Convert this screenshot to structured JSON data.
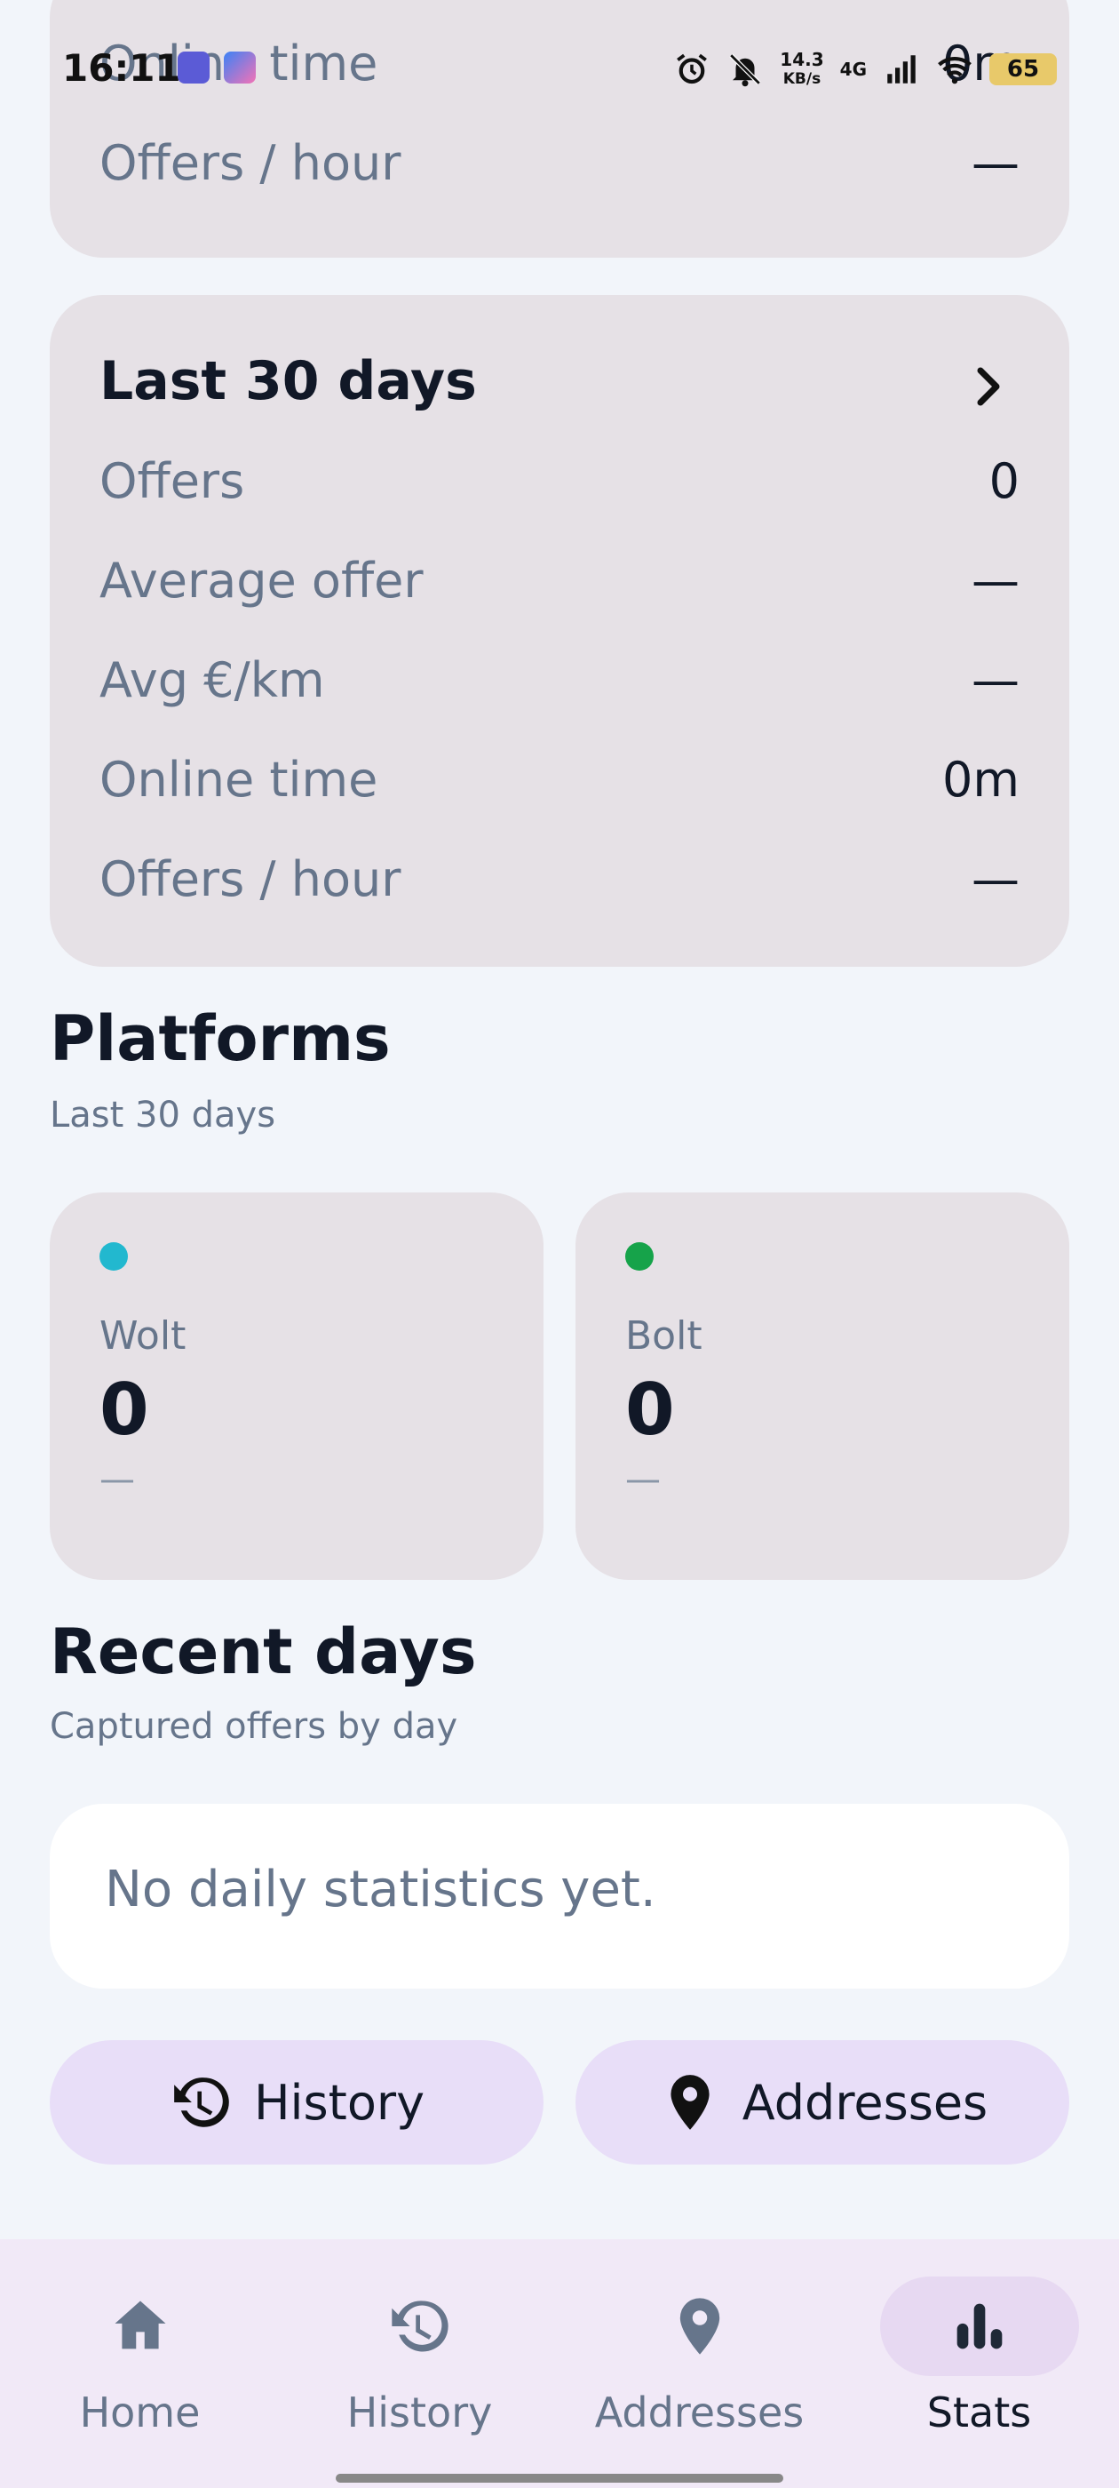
{
  "status_bar": {
    "time": "16:11",
    "net_speed_value": "14.3",
    "net_speed_unit": "KB/s",
    "network_type": "4G",
    "battery": "65"
  },
  "top_card": {
    "rows": [
      {
        "label": "Online time",
        "value": "0m"
      },
      {
        "label": "Offers / hour",
        "value": "—"
      }
    ]
  },
  "last30_card": {
    "title": "Last 30 days",
    "rows": [
      {
        "label": "Offers",
        "value": "0"
      },
      {
        "label": "Average offer",
        "value": "—"
      },
      {
        "label": "Avg €/km",
        "value": "—"
      },
      {
        "label": "Online time",
        "value": "0m"
      },
      {
        "label": "Offers / hour",
        "value": "—"
      }
    ]
  },
  "platforms": {
    "title": "Platforms",
    "subtitle": "Last 30 days",
    "items": [
      {
        "name": "Wolt",
        "count": "0",
        "sub": "—",
        "color": "#22b8cf"
      },
      {
        "name": "Bolt",
        "count": "0",
        "sub": "—",
        "color": "#16a34a"
      }
    ]
  },
  "recent_days": {
    "title": "Recent days",
    "subtitle": "Captured offers by day",
    "empty_text": "No daily statistics yet."
  },
  "buttons": {
    "history": "History",
    "addresses": "Addresses"
  },
  "nav": {
    "items": [
      {
        "label": "Home",
        "icon": "home-icon"
      },
      {
        "label": "History",
        "icon": "history-icon"
      },
      {
        "label": "Addresses",
        "icon": "location-pin-icon"
      },
      {
        "label": "Stats",
        "icon": "bar-chart-icon"
      }
    ],
    "active": "Stats"
  },
  "colors": {
    "background": "#f2f5fa",
    "card": "#e6e1e6",
    "pill": "#e8def8",
    "nav_bg": "#f1e9f7",
    "nav_active": "#e7d9f2",
    "muted_text": "#66758b"
  }
}
